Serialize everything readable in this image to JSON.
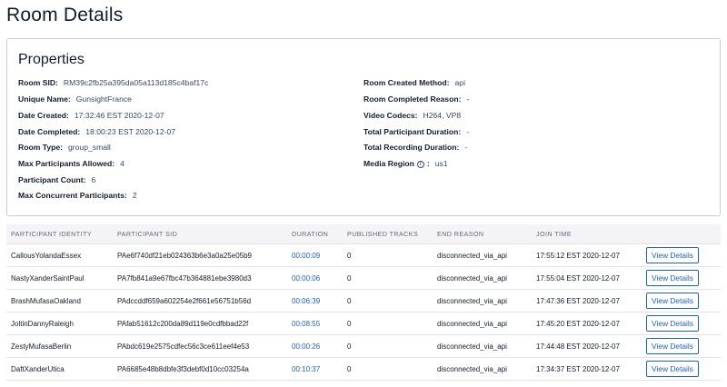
{
  "page": {
    "title": "Room Details"
  },
  "properties": {
    "heading": "Properties",
    "left": [
      {
        "key": "Room SID:",
        "value": "RM39c2fb25a395da05a113d185c4baf17c"
      },
      {
        "key": "Unique Name:",
        "value": "GunsightFrance"
      },
      {
        "key": "Date Created:",
        "value": "17:32:46 EST 2020-12-07"
      },
      {
        "key": "Date Completed:",
        "value": "18:00:23 EST 2020-12-07"
      },
      {
        "key": "Room Type:",
        "value": "group_small"
      },
      {
        "key": "Max Participants Allowed:",
        "value": "4"
      },
      {
        "key": "Participant Count:",
        "value": "6"
      },
      {
        "key": "Max Concurrent Participants:",
        "value": "2"
      }
    ],
    "right": [
      {
        "key": "Room Created Method:",
        "value": "api"
      },
      {
        "key": "Room Completed Reason:",
        "value": "-"
      },
      {
        "key": "Video Codecs:",
        "value": "H264, VP8"
      },
      {
        "key": "Total Participant Duration:",
        "value": "-"
      },
      {
        "key": "Total Recording Duration:",
        "value": "-"
      },
      {
        "key": "Media Region",
        "icon": "info-icon",
        "colon": ":",
        "value": "us1"
      }
    ]
  },
  "table": {
    "headers": [
      "Participant Identity",
      "Participant SID",
      "Duration",
      "Published Tracks",
      "End Reason",
      "Join Time"
    ],
    "button_label": "View Details",
    "rows": [
      [
        "CallousYolandaEssex",
        "PAe6f740df21eb024363b6e3a0a25e05b9",
        "00:00:09",
        "0",
        "disconnected_via_api",
        "17:55:12 EST 2020-12-07"
      ],
      [
        "NastyXanderSaintPaul",
        "PA7fb841a9e67fbc47b364881ebe3980d3",
        "00:00:06",
        "0",
        "disconnected_via_api",
        "17:55:04 EST 2020-12-07"
      ],
      [
        "BrashMufasaOakland",
        "PAdccddf659a602254e2f661e56751b56d",
        "00:06:39",
        "0",
        "disconnected_via_api",
        "17:47:36 EST 2020-12-07"
      ],
      [
        "JoltinDannyRaleigh",
        "PAfab51612c200da89d119e0cdfbbad22f",
        "00:08:55",
        "0",
        "disconnected_via_api",
        "17:45:20 EST 2020-12-07"
      ],
      [
        "ZestyMufasaBerlin",
        "PAbdc619e2575cdfec56c3ce611eef4e53",
        "00:00:26",
        "0",
        "disconnected_via_api",
        "17:44:48 EST 2020-12-07"
      ],
      [
        "DaftXanderUtica",
        "PA6685e48b8dbfe3f3debf0d10cc03254a",
        "00:10:37",
        "0",
        "disconnected_via_api",
        "17:34:37 EST 2020-12-07"
      ]
    ]
  },
  "colors": {
    "link": "#1f5fc4",
    "text": "#121c2d",
    "border": "#c9ced6"
  }
}
